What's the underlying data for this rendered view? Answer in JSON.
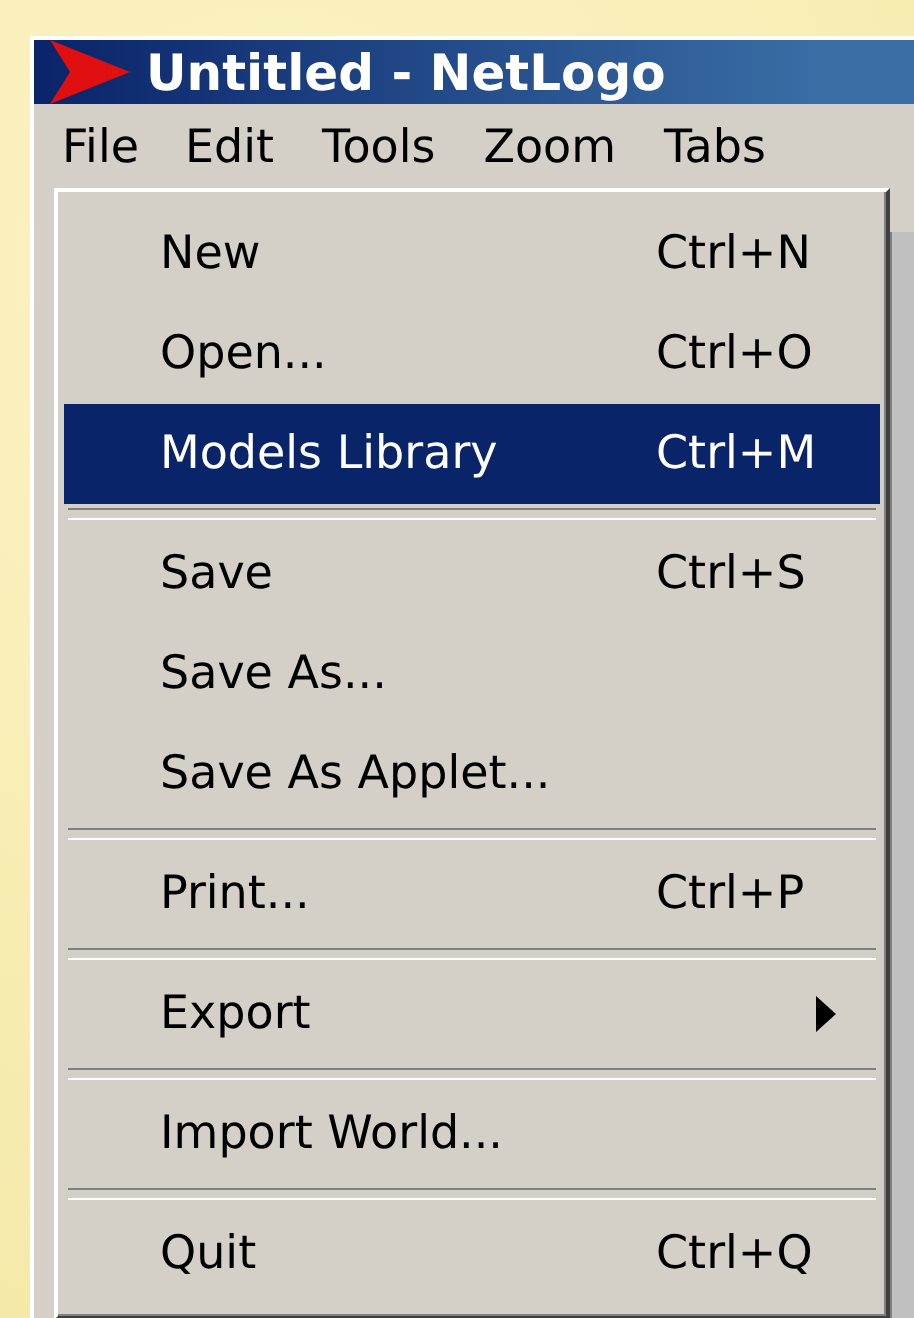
{
  "window": {
    "title": "Untitled - NetLogo"
  },
  "menu_bar": [
    {
      "label": "File",
      "selected": true
    },
    {
      "label": "Edit",
      "selected": false
    },
    {
      "label": "Tools",
      "selected": false
    },
    {
      "label": "Zoom",
      "selected": false
    },
    {
      "label": "Tabs",
      "selected": false
    }
  ],
  "file_menu": [
    {
      "kind": "item",
      "label": "New",
      "shortcut": "Ctrl+N",
      "selected": false
    },
    {
      "kind": "item",
      "label": "Open...",
      "shortcut": "Ctrl+O",
      "selected": false
    },
    {
      "kind": "item",
      "label": "Models Library",
      "shortcut": "Ctrl+M",
      "selected": true
    },
    {
      "kind": "separator"
    },
    {
      "kind": "item",
      "label": "Save",
      "shortcut": "Ctrl+S",
      "selected": false
    },
    {
      "kind": "item",
      "label": "Save As...",
      "selected": false
    },
    {
      "kind": "item",
      "label": "Save As Applet...",
      "selected": false
    },
    {
      "kind": "separator"
    },
    {
      "kind": "item",
      "label": "Print...",
      "shortcut": "Ctrl+P",
      "selected": false
    },
    {
      "kind": "separator"
    },
    {
      "kind": "submenu",
      "label": "Export",
      "selected": false
    },
    {
      "kind": "separator"
    },
    {
      "kind": "item",
      "label": "Import World...",
      "selected": false
    },
    {
      "kind": "separator"
    },
    {
      "kind": "item",
      "label": "Quit",
      "shortcut": "Ctrl+Q",
      "selected": false
    }
  ]
}
